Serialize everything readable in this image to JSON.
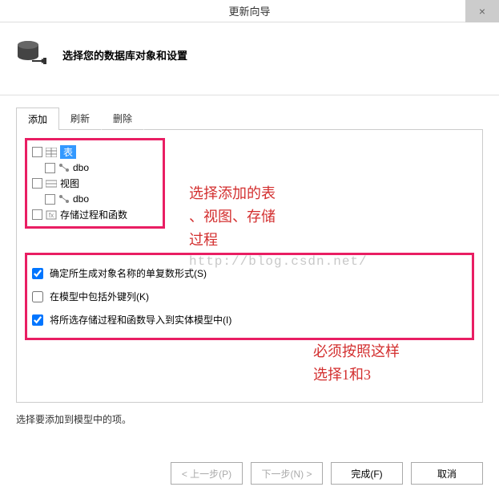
{
  "title": "更新向导",
  "close_glyph": "×",
  "header": {
    "text": "选择您的数据库对象和设置"
  },
  "tabs": {
    "t0": "添加",
    "t1": "刷新",
    "t2": "删除"
  },
  "tree": {
    "tables": "表",
    "tables_dbo": "dbo",
    "views": "视图",
    "views_dbo": "dbo",
    "sprocs": "存储过程和函数"
  },
  "annotations": {
    "a1_l1": "选择添加的表",
    "a1_l2": "、视图、存储",
    "a1_l3": "过程",
    "a2_l1": "必须按照这样",
    "a2_l2": "选择1和3"
  },
  "watermark": "http://blog.csdn.net/",
  "options": {
    "o1": "确定所生成对象名称的单复数形式(S)",
    "o2": "在模型中包括外键列(K)",
    "o3": "将所选存储过程和函数导入到实体模型中(I)"
  },
  "hint": "选择要添加到模型中的项。",
  "buttons": {
    "prev": "< 上一步(P)",
    "next": "下一步(N) >",
    "finish": "完成(F)",
    "cancel": "取消"
  }
}
